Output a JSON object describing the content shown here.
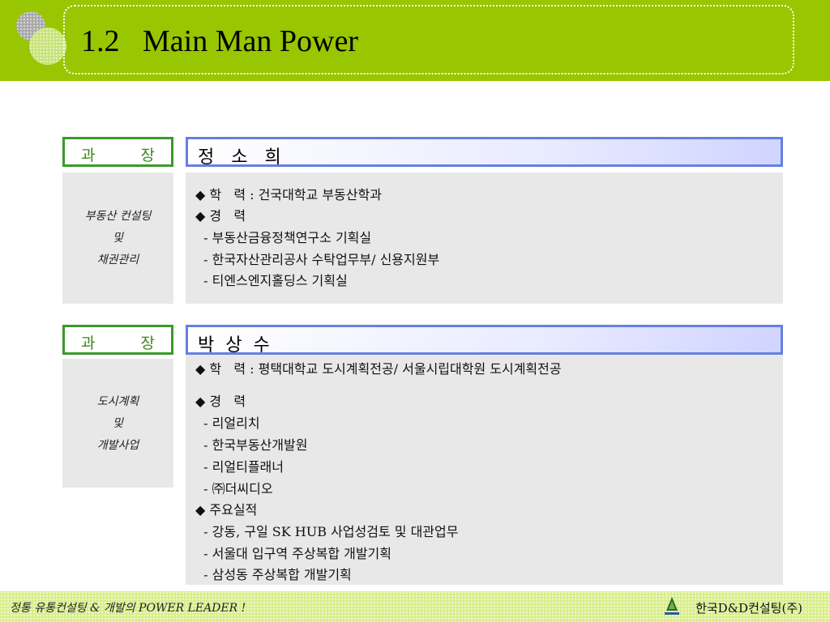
{
  "slide": {
    "title": "1.2   Main Man Power"
  },
  "profiles": [
    {
      "rank": [
        "과",
        "장"
      ],
      "name": "정   소   희",
      "field": [
        "부동산 컨설팅",
        "및",
        "채권관리"
      ],
      "details": [
        "◆ 학   력 : 건국대학교 부동산학과",
        "◆ 경   력",
        "  - 부동산금융정책연구소 기획실",
        "  - 한국자산관리공사 수탁업무부/ 신용지원부",
        "  - 티엔스엔지홀딩스 기획실"
      ]
    },
    {
      "rank": [
        "과",
        "장"
      ],
      "name": "박  상  수",
      "field": [
        "도시계획",
        "및",
        "개발사업"
      ],
      "details": [
        "◆ 학   력 : 평택대학교 도시계획전공/ 서울시립대학원 도시계획전공",
        "◆ 경   력",
        "  - 리얼리치",
        "  - 한국부동산개발원",
        "  - 리얼티플래너",
        "  - ㈜더씨디오",
        "◆ 주요실적",
        "  - 강동, 구일 SK HUB 사업성검토 및 대관업무",
        "  - 서울대 입구역 주상복합 개발기획",
        "  - 삼성동 주상복합 개발기획"
      ]
    }
  ],
  "footer": {
    "slogan": "정통 유통컨설팅 & 개발의 POWER LEADER !",
    "company": "한국D&D컨설팅(주)"
  }
}
